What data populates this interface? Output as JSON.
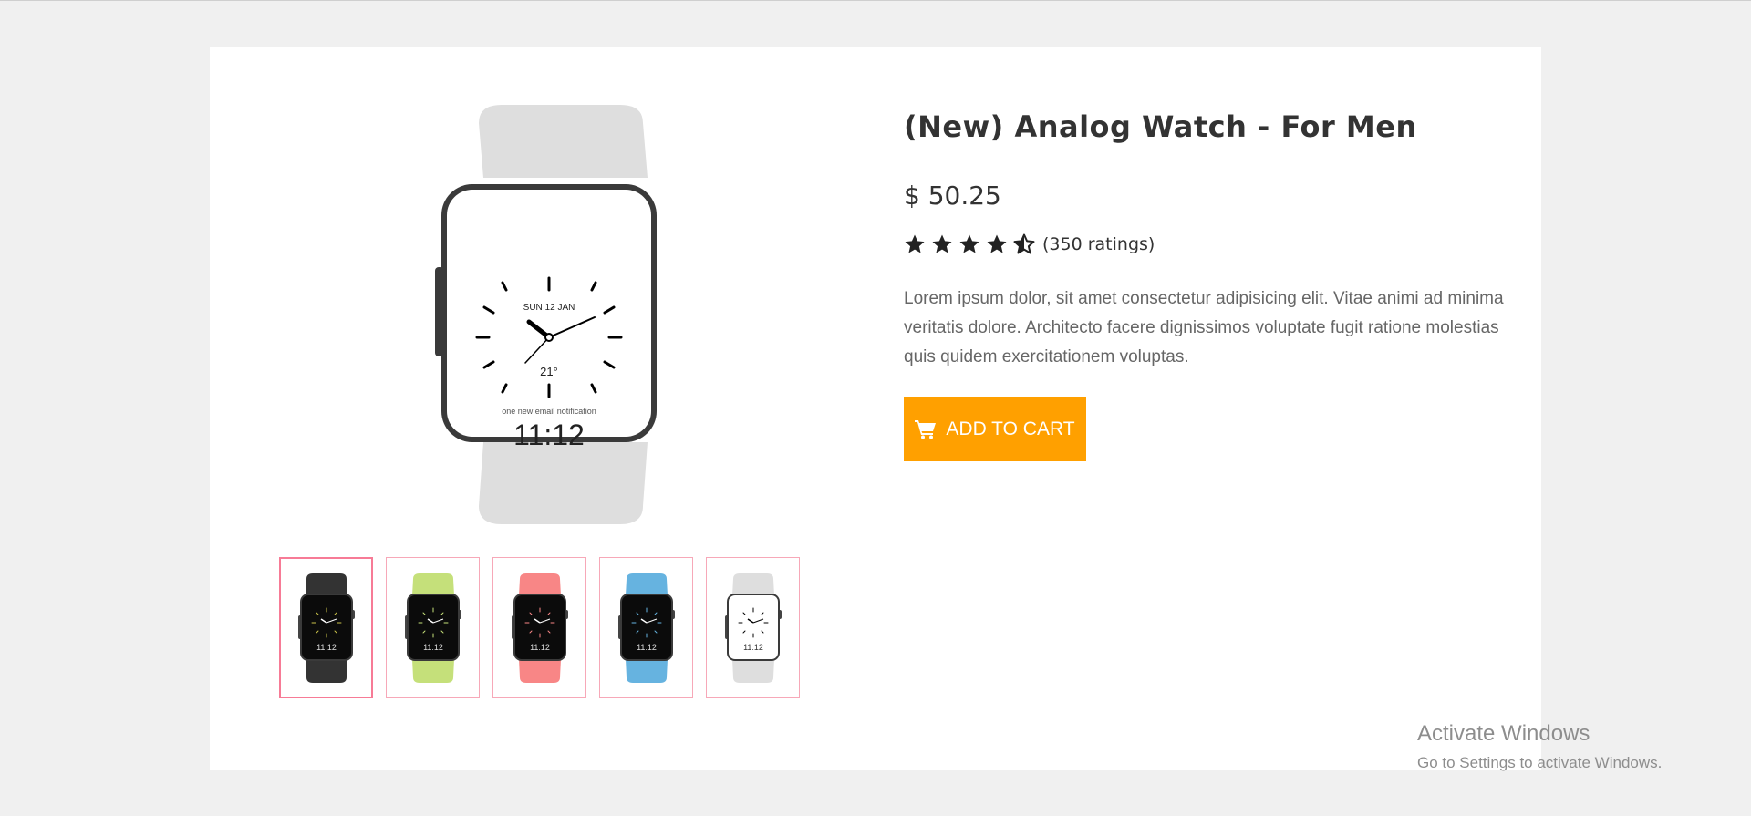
{
  "product": {
    "title": "(New) Analog Watch - For Men",
    "price": "$ 50.25",
    "rating": 4.5,
    "rating_count": "(350 ratings)",
    "description": "Lorem ipsum dolor, sit amet consectetur adipisicing elit. Vitae animi ad minima veritatis dolore. Architecto facere dignissimos voluptate fugit ratione molestias quis quidem exercitationem voluptas.",
    "add_to_cart_label": "ADD TO CART",
    "cart_icon": "cart-icon",
    "accent_color": "#ffa000"
  },
  "main_watch": {
    "date_text": "SUN 12 JAN",
    "temperature": "21°",
    "notification": "one new email notification",
    "time": "11:12",
    "band_color": "#dedede"
  },
  "thumbnails": [
    {
      "color": "black",
      "band": "#333333",
      "time": "11:12"
    },
    {
      "color": "green",
      "band": "#c5e07a",
      "time": "11:12"
    },
    {
      "color": "red",
      "band": "#f88686",
      "time": "11:12"
    },
    {
      "color": "blue",
      "band": "#66b3e0",
      "time": "11:12"
    },
    {
      "color": "white",
      "band": "#dedede",
      "time": "11:12"
    }
  ],
  "watermark": {
    "line1": "Activate Windows",
    "line2": "Go to Settings to activate Windows."
  }
}
